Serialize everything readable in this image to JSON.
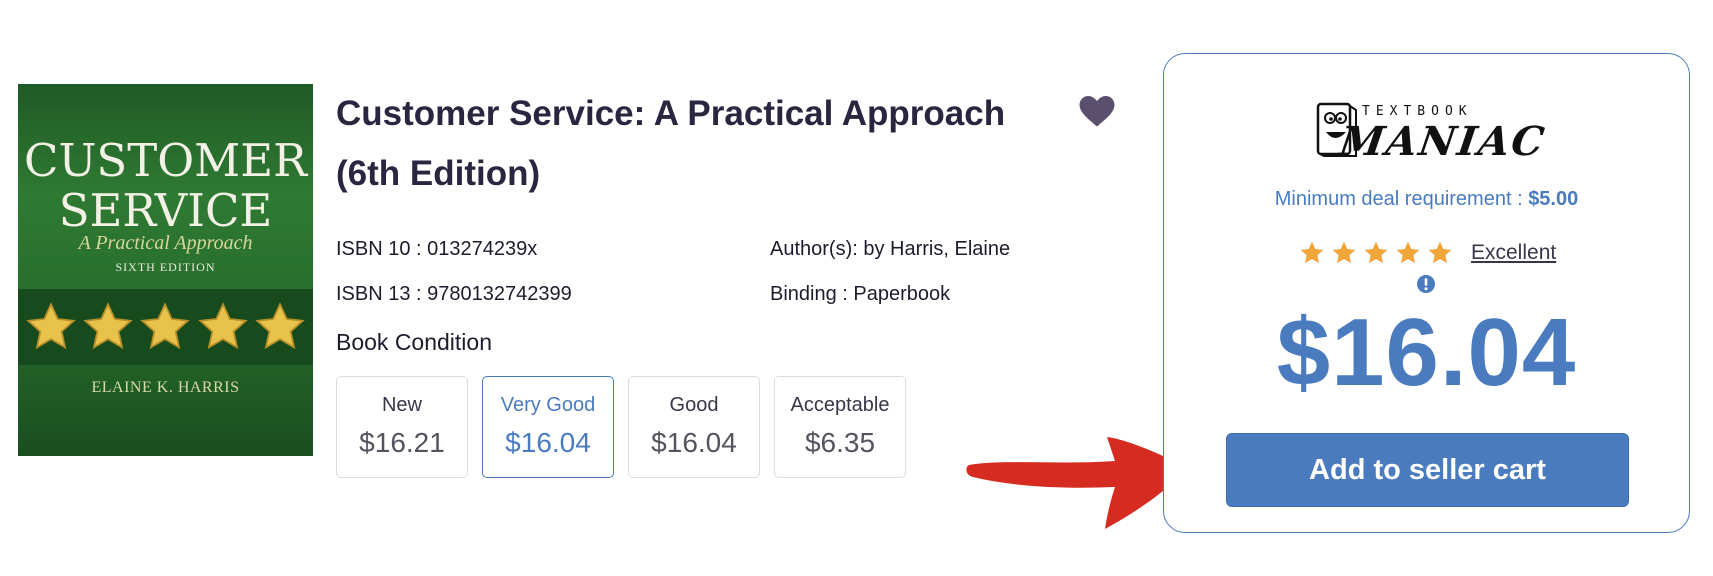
{
  "book": {
    "cover": {
      "title_line1": "CUSTOMER",
      "title_line2": "SERVICE",
      "subtitle": "A Practical Approach",
      "edition": "SIXTH EDITION",
      "author": "ELAINE K. HARRIS",
      "star_count": 5
    },
    "title": "Customer Service: A Practical Approach (6th Edition)",
    "isbn10": "ISBN 10 : 013274239x",
    "isbn13": "ISBN 13 : 9780132742399",
    "author": "Author(s): by Harris, Elaine",
    "binding": "Binding : Paperbook",
    "condition_label": "Book Condition",
    "conditions": [
      {
        "name": "New",
        "price": "$16.21",
        "selected": false
      },
      {
        "name": "Very Good",
        "price": "$16.04",
        "selected": true
      },
      {
        "name": "Good",
        "price": "$16.04",
        "selected": false
      },
      {
        "name": "Acceptable",
        "price": "$6.35",
        "selected": false
      }
    ]
  },
  "seller": {
    "logo_small": "TEXTBOOK",
    "logo_big": "MANIAC",
    "min_deal_label": "Minimum deal requirement : ",
    "min_deal_value": "$5.00",
    "rating_stars": 5,
    "rating_text": "Excellent",
    "price": "$16.04",
    "cart_button": "Add to seller cart"
  },
  "colors": {
    "accent": "#4a7bbf",
    "star": "#f0a63a",
    "arrow": "#d62b20",
    "heart": "#5b4f6e",
    "text_dark": "#2b2540"
  },
  "icons": {
    "favorite": "heart-icon",
    "info": "info-icon",
    "rating": "star-icon",
    "annotation": "red-arrow"
  }
}
